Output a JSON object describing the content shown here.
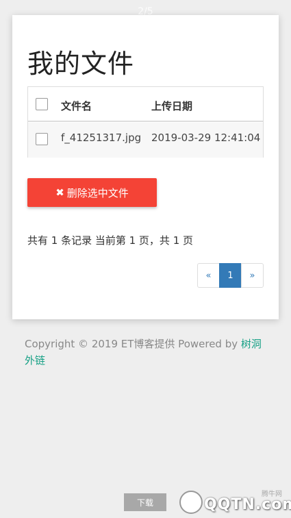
{
  "page_indicator": "2/5",
  "card": {
    "title": "我的文件",
    "table": {
      "headers": [
        "文件名",
        "上传日期"
      ],
      "rows": [
        {
          "name": "f_41251317.jpg",
          "date": "2019-03-29 12:41:04"
        }
      ]
    },
    "delete_button": "删除选中文件",
    "record_info": "共有 1 条记录  当前第 1 页，共 1 页",
    "pagination": {
      "prev": "«",
      "current": "1",
      "next": "»"
    }
  },
  "footer": {
    "text": "Copyright © 2019 ET博客提供 Powered by ",
    "link": "树洞外链"
  },
  "download_button": "下载",
  "watermark": {
    "small": "腾牛网",
    "logo": "QQTN.com"
  },
  "colors": {
    "danger": "#f44336",
    "primary": "#337ab7",
    "link": "#16a085",
    "background": "#eeeeee"
  }
}
